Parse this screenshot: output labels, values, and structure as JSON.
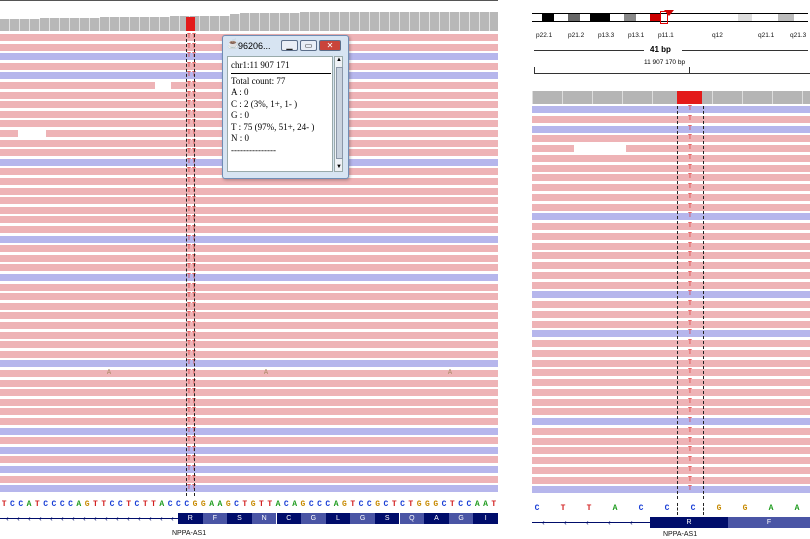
{
  "popup": {
    "title": "96206...",
    "locus": "chr1:11 907 171",
    "total_count": "Total count: 77",
    "a": "A : 0",
    "c": "C : 2 (3%, 1+, 1- )",
    "g": "G : 0",
    "t": "T : 75 (97%, 51+, 24- )",
    "n": "N : 0",
    "separator": "---------------"
  },
  "left": {
    "sequence": "TCCATCCCCAGTTCCTCTTACCCGGAAGCTGTTACAGCCCAGTCCGCTCTGGGCTCCAAT",
    "amino_acids": [
      "R",
      "F",
      "S",
      "N",
      "C",
      "G",
      "L",
      "G",
      "S",
      "Q",
      "A",
      "G",
      "I"
    ],
    "gene": "NPPA-AS1",
    "mismatch_base": "T",
    "stray_base": "A"
  },
  "right": {
    "cytobands": [
      "p22.1",
      "p21.2",
      "p13.3",
      "p13.1",
      "p11.1",
      "q12",
      "q21.1",
      "q21.3"
    ],
    "span": "41 bp",
    "position": "11 907 170 bp",
    "sequence": [
      "C",
      "T",
      "T",
      "A",
      "C",
      "C",
      "C",
      "G",
      "G",
      "A",
      "A"
    ],
    "amino_acids": [
      "R",
      "F"
    ],
    "gene": "NPPA-AS1",
    "mismatch_base": "T"
  },
  "colors": {
    "read_pos": "#eeb3b6",
    "read_neg": "#b6b6ec",
    "coverage": "#b8b8b8",
    "highlight": "#e31a1a",
    "aa_dark": "#000d6b",
    "aa_light": "#4a55a5",
    "base_A": "#1a9a1a",
    "base_C": "#1a3fd6",
    "base_G": "#c78a00",
    "base_T": "#d21e1e"
  }
}
